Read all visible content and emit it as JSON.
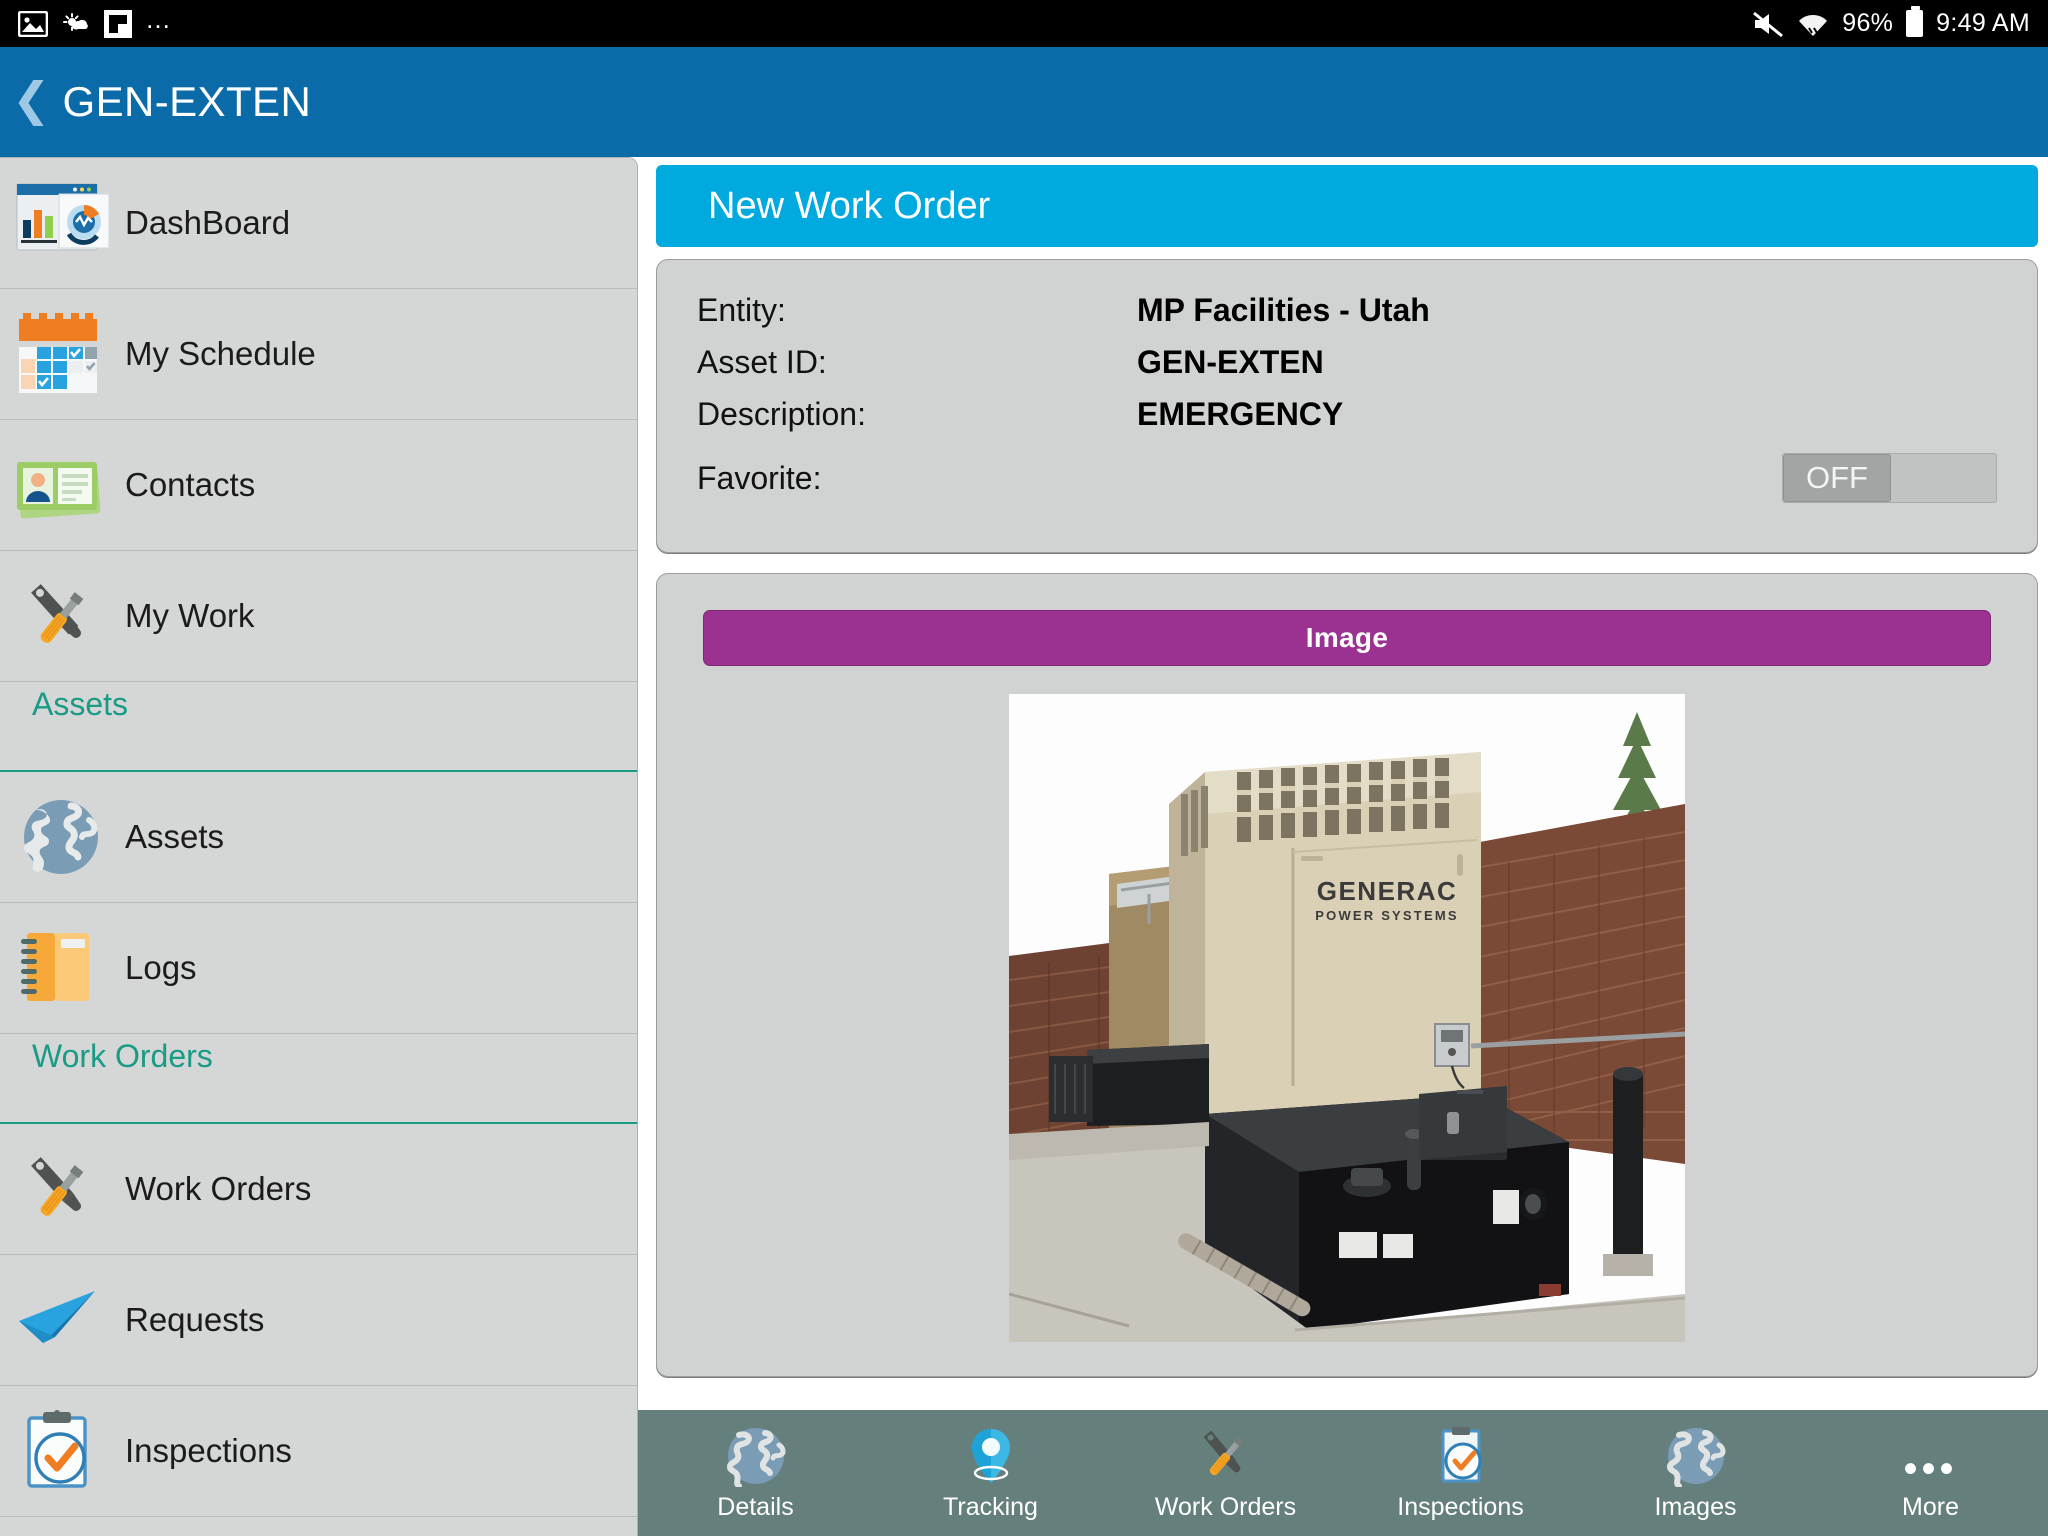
{
  "statusbar": {
    "left_icons": [
      "image-icon",
      "weather-icon",
      "flipboard-icon",
      "overflow-dots-icon"
    ],
    "overflow": "…",
    "mute_icon": "mute-icon",
    "wifi_icon": "wifi-icon",
    "battery_percent": "96%",
    "battery_icon": "battery-full-icon",
    "time": "9:49 AM"
  },
  "appbar": {
    "back_icon": "❮",
    "title": "GEN-EXTEN"
  },
  "sidebar": {
    "items": [
      {
        "type": "item",
        "label": "DashBoard",
        "icon": "dashboard-icon"
      },
      {
        "type": "item",
        "label": "My Schedule",
        "icon": "calendar-icon"
      },
      {
        "type": "item",
        "label": "Contacts",
        "icon": "contacts-icon"
      },
      {
        "type": "item",
        "label": "My Work",
        "icon": "tools-icon"
      },
      {
        "type": "group",
        "label": "Assets"
      },
      {
        "type": "item",
        "label": "Assets",
        "icon": "globe-icon"
      },
      {
        "type": "item",
        "label": "Logs",
        "icon": "notebook-icon"
      },
      {
        "type": "group",
        "label": "Work Orders"
      },
      {
        "type": "item",
        "label": "Work Orders",
        "icon": "tools-icon"
      },
      {
        "type": "item",
        "label": "Requests",
        "icon": "paper-plane-icon"
      },
      {
        "type": "item",
        "label": "Inspections",
        "icon": "clipboard-check-icon"
      }
    ]
  },
  "main": {
    "panel_title": "New Work Order",
    "details": {
      "rows": [
        {
          "label": "Entity:",
          "value": "MP Facilities - Utah"
        },
        {
          "label": "Asset ID:",
          "value": "GEN-EXTEN"
        },
        {
          "label": "Description:",
          "value": "EMERGENCY"
        }
      ],
      "favorite_label": "Favorite:",
      "favorite_toggle": "OFF"
    },
    "image_section": {
      "banner": "Image",
      "photo_alt": "GENERAC POWER SYSTEMS standby generator on black fuel tank base in brick enclosure",
      "photo_brand": "GENERAC",
      "photo_brand_sub": "POWER SYSTEMS"
    }
  },
  "bottomnav": {
    "items": [
      {
        "label": "Details",
        "icon": "globe-icon"
      },
      {
        "label": "Tracking",
        "icon": "map-pin-icon"
      },
      {
        "label": "Work Orders",
        "icon": "tools-icon"
      },
      {
        "label": "Inspections",
        "icon": "clipboard-check-icon"
      },
      {
        "label": "Images",
        "icon": "globe-icon"
      },
      {
        "label": "More",
        "icon": "overflow-dots-icon"
      }
    ],
    "more_dots": "•••"
  },
  "colors": {
    "status_bar": "#000000",
    "app_bar": "#0b6ba8",
    "panel_title": "#00aade",
    "image_banner": "#9b3191",
    "group_header": "#1a9b86",
    "bottom_nav": "#65807c",
    "card_bg": "#d0d3d2",
    "sidebar_bg": "#d4d7d6"
  }
}
